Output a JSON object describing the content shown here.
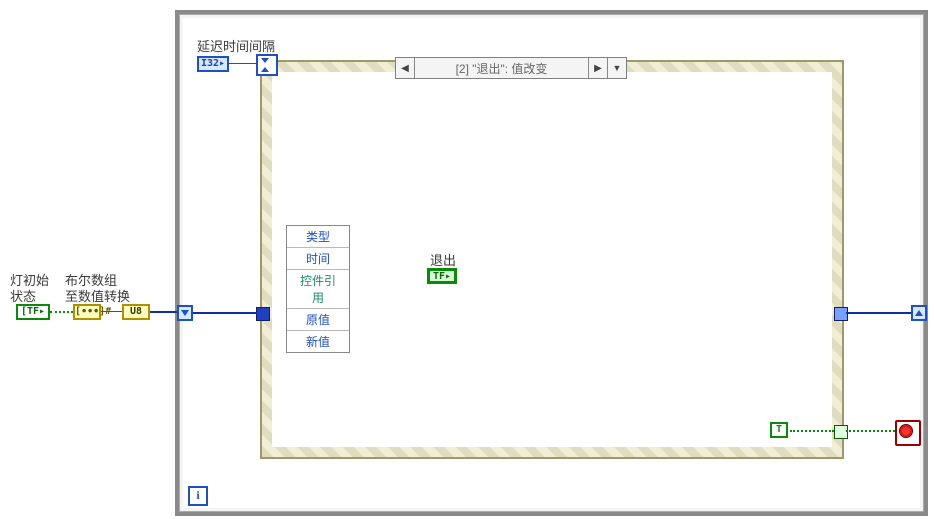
{
  "labels": {
    "delay_interval": "延迟时间间隔",
    "light_initial_state_l1": "灯初始",
    "light_initial_state_l2": "状态",
    "bool_array_l1": "布尔数组",
    "bool_array_l2": "至数值转换",
    "exit": "退出"
  },
  "terminals": {
    "bracket_tf": "[TF▸",
    "dots": "[∙∙∙]#",
    "u8": "U8",
    "i32": "I32▸",
    "tf": "TF▸",
    "true_const": "T",
    "iter": "i"
  },
  "event_data_rows": [
    "类型",
    "时间",
    "控件引用",
    "原值",
    "新值"
  ],
  "case_selector": {
    "caption": "[2] \"退出\": 值改变",
    "left_arrow": "◀",
    "right_arrow": "▶",
    "dropdown": "▼"
  }
}
